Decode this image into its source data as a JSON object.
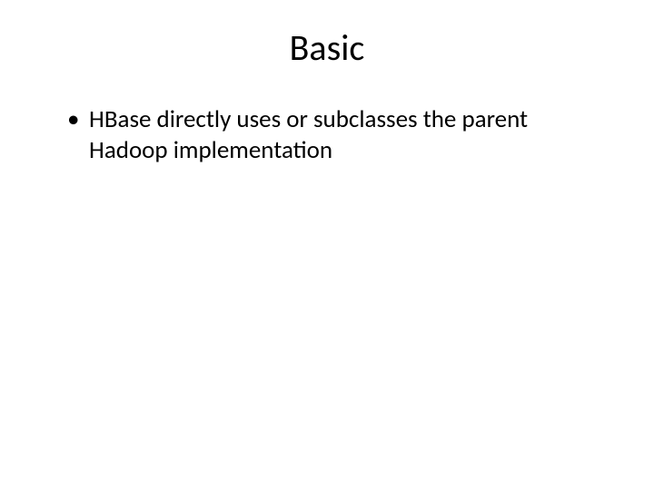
{
  "slide": {
    "title": "Basic",
    "bullets": [
      {
        "text": "HBase directly uses or subclasses the parent Hadoop implementation"
      }
    ]
  }
}
